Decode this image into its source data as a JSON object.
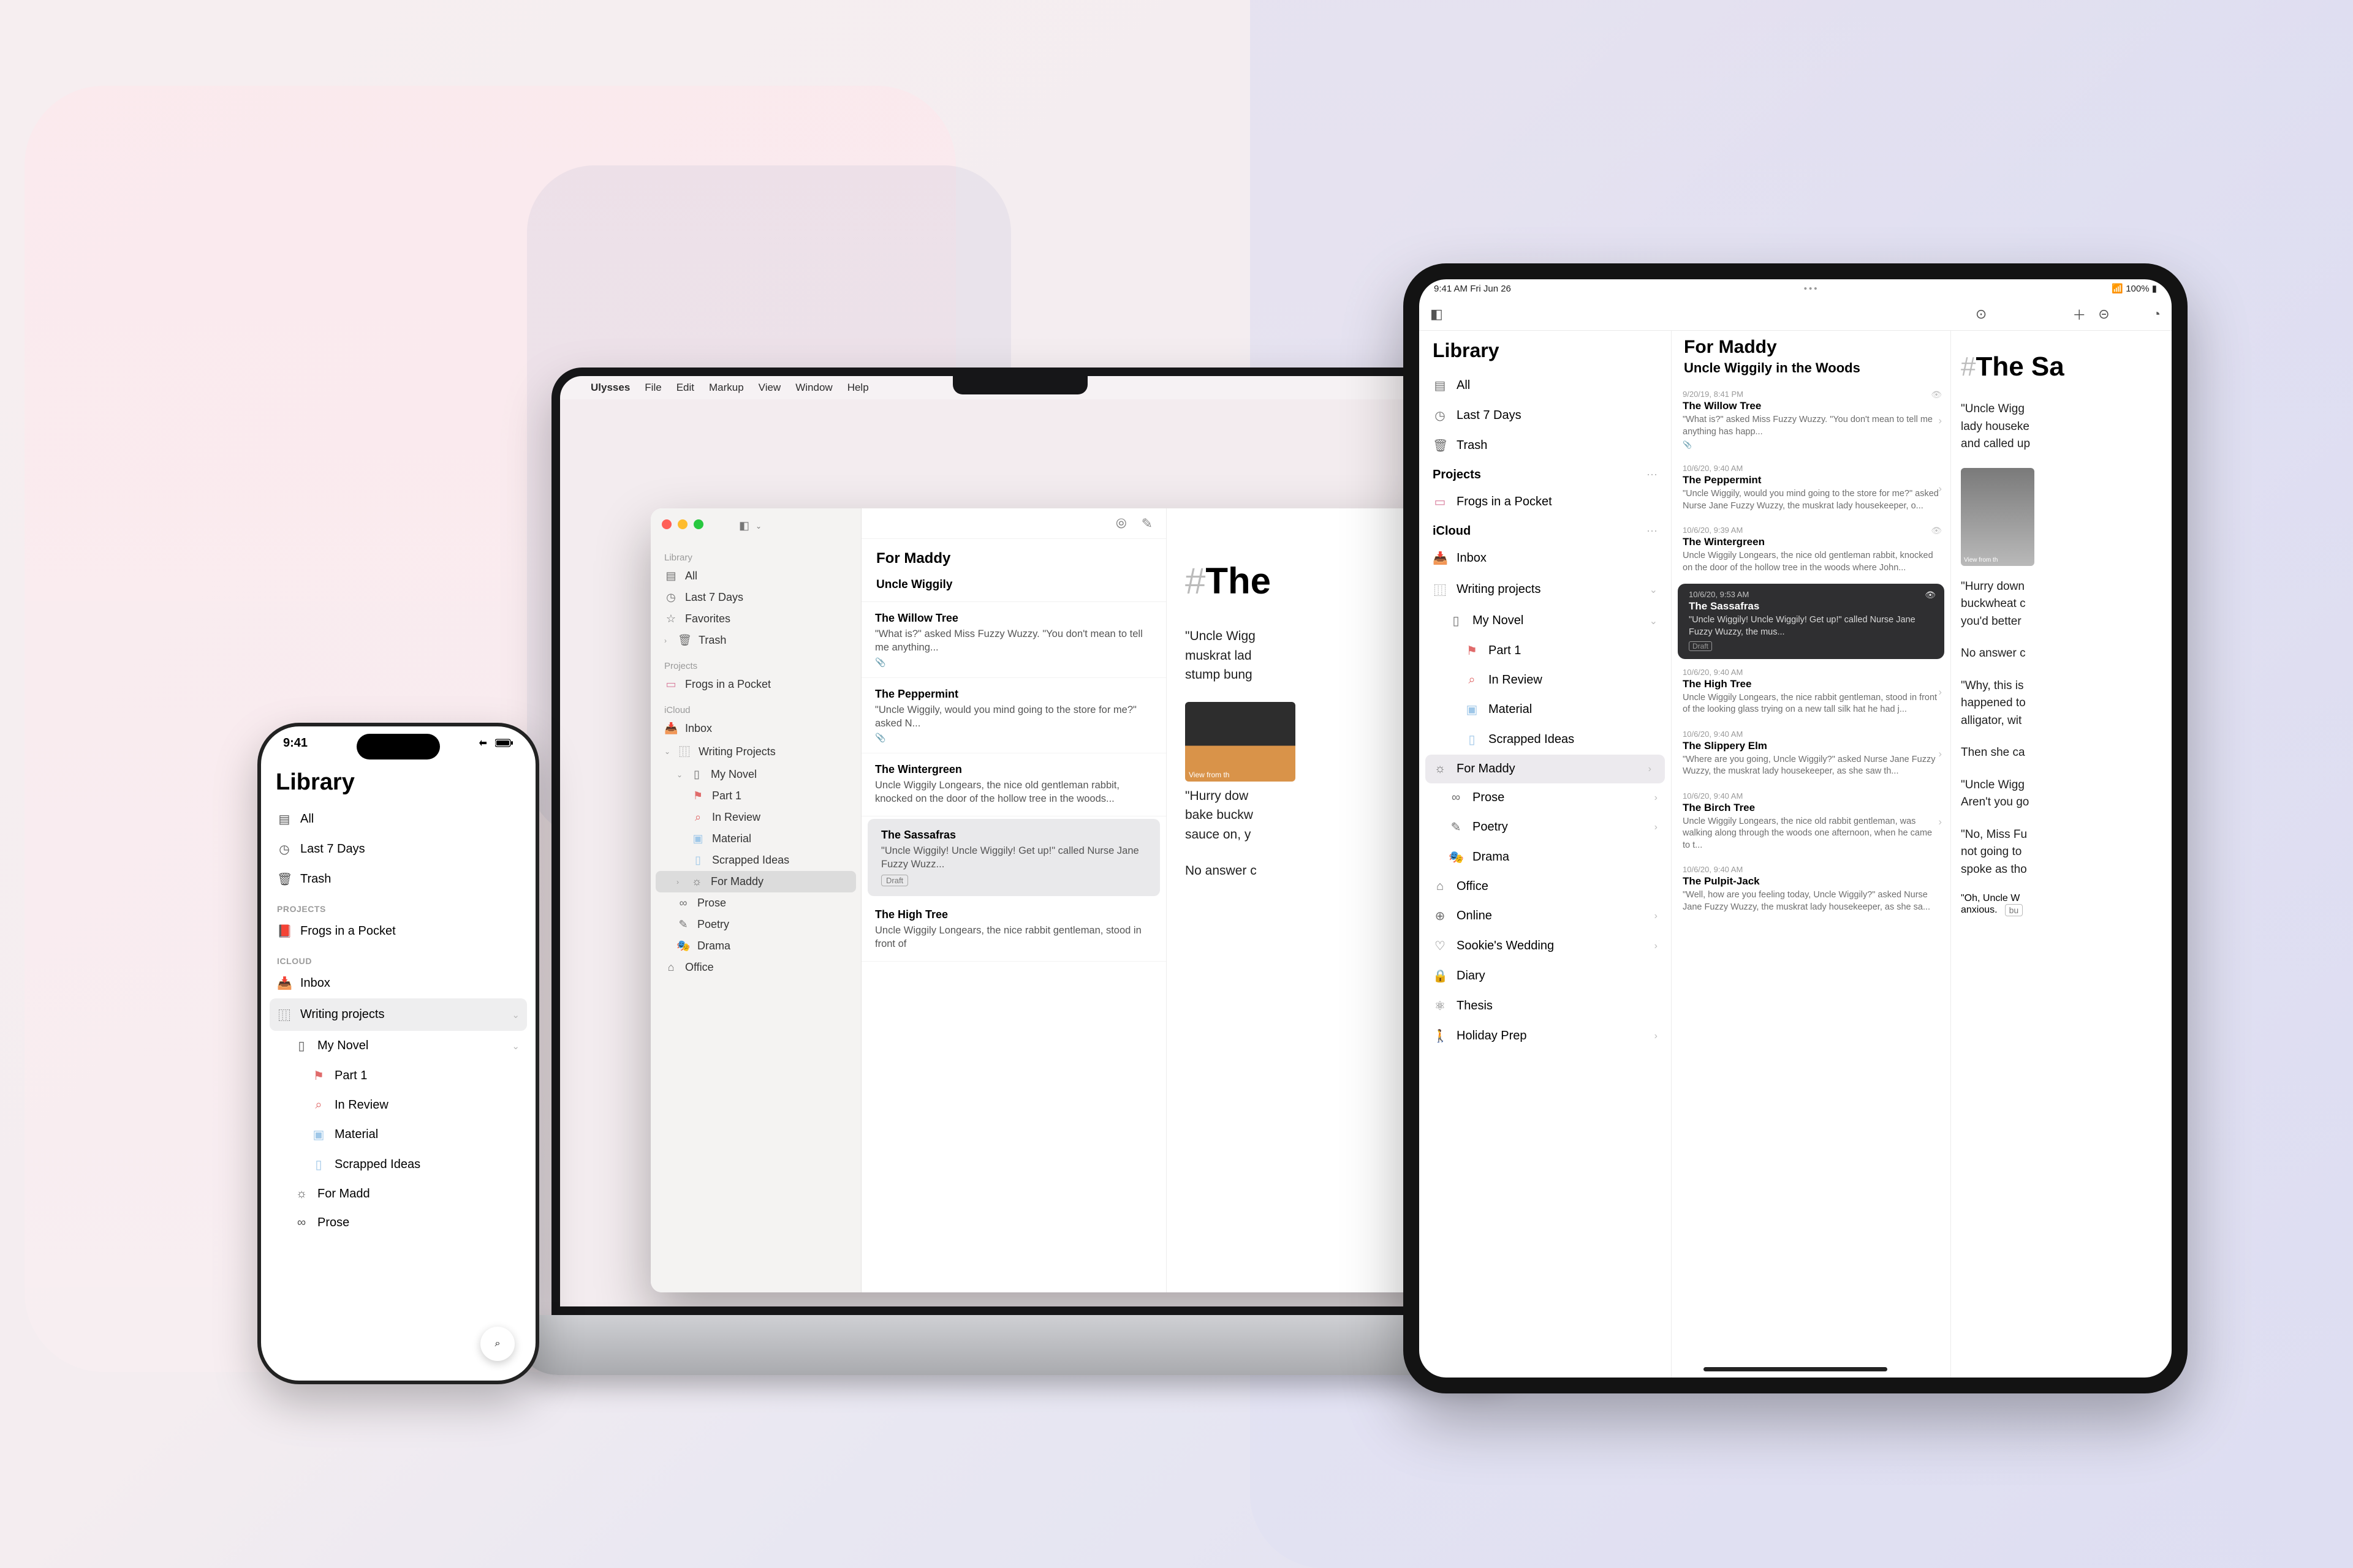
{
  "iphone": {
    "status_time": "9:41",
    "library_title": "Library",
    "filters": {
      "all": "All",
      "last7": "Last 7 Days",
      "trash": "Trash"
    },
    "projects_header": "PROJECTS",
    "project_frogs": "Frogs in a Pocket",
    "icloud_header": "ICLOUD",
    "inbox": "Inbox",
    "writing_projects": "Writing projects",
    "my_novel": "My Novel",
    "part1": "Part 1",
    "in_review": "In Review",
    "material": "Material",
    "scrapped": "Scrapped Ideas",
    "for_maddy": "For Madd",
    "prose": "Prose"
  },
  "mac": {
    "menus": {
      "apple": "",
      "ulysses": "Ulysses",
      "file": "File",
      "edit": "Edit",
      "markup": "Markup",
      "view": "View",
      "window": "Window",
      "help": "Help"
    },
    "sidebar": {
      "library_head": "Library",
      "all": "All",
      "last7": "Last 7 Days",
      "favorites": "Favorites",
      "trash": "Trash",
      "projects_head": "Projects",
      "frogs": "Frogs in a Pocket",
      "icloud_head": "iCloud",
      "inbox": "Inbox",
      "writing": "Writing Projects",
      "my_novel": "My Novel",
      "part1": "Part 1",
      "in_review": "In Review",
      "material": "Material",
      "scrapped": "Scrapped Ideas",
      "for_maddy": "For Maddy",
      "prose": "Prose",
      "poetry": "Poetry",
      "drama": "Drama",
      "office": "Office"
    },
    "list": {
      "title": "For Maddy",
      "subtitle": "Uncle Wiggily",
      "items": [
        {
          "title": "The Willow Tree",
          "snippet": "\"What is?\" asked Miss Fuzzy Wuzzy. \"You don't mean to tell me anything...",
          "attachment": true
        },
        {
          "title": "The Peppermint",
          "snippet": "\"Uncle Wiggily, would you mind going to the store for me?\" asked N...",
          "attachment": true
        },
        {
          "title": "The Wintergreen",
          "snippet": "Uncle Wiggily Longears, the nice old gentleman rabbit, knocked on the door of the hollow tree in the woods..."
        },
        {
          "title": "The Sassafras",
          "snippet": "\"Uncle Wiggily! Uncle Wiggily! Get up!\" called Nurse Jane Fuzzy Wuzz...",
          "draft": "Draft",
          "selected": true
        },
        {
          "title": "The High Tree",
          "snippet": "Uncle Wiggily Longears, the nice rabbit gentleman, stood in front of"
        }
      ]
    },
    "editor": {
      "prefix": "#",
      "heading": "The",
      "p1": "\"Uncle Wigg",
      "p1b": "muskrat lad",
      "p1c": "stump bung",
      "image_caption": "View from th",
      "p2": "\"Hurry dow",
      "p2b": "bake buckw",
      "p2c": "sauce on, y",
      "p3": "No answer c"
    }
  },
  "ipad": {
    "status_time": "9:41 AM  Fri Jun 26",
    "status_batt": "100%",
    "library_title": "Library",
    "filters": {
      "all": "All",
      "last7": "Last 7 Days",
      "trash": "Trash"
    },
    "projects_head": "Projects",
    "frogs": "Frogs in a Pocket",
    "icloud_head": "iCloud",
    "inbox": "Inbox",
    "writing": "Writing projects",
    "my_novel": "My Novel",
    "part1": "Part 1",
    "in_review": "In Review",
    "material": "Material",
    "scrapped": "Scrapped Ideas",
    "for_maddy": "For Maddy",
    "prose": "Prose",
    "poetry": "Poetry",
    "drama": "Drama",
    "office": "Office",
    "online": "Online",
    "sookie": "Sookie's Wedding",
    "diary": "Diary",
    "thesis": "Thesis",
    "holiday": "Holiday Prep",
    "list": {
      "title": "For Maddy",
      "subtitle": "Uncle Wiggily in the Woods",
      "items": [
        {
          "date": "9/20/19, 8:41 PM",
          "title": "The Willow Tree",
          "snippet": "\"What is?\" asked Miss Fuzzy Wuzzy. \"You don't mean to tell me anything has happ...",
          "attachment": true,
          "eye": true
        },
        {
          "date": "10/6/20, 9:40 AM",
          "title": "The Peppermint",
          "snippet": "\"Uncle Wiggily, would you mind going to the store for me?\" asked Nurse Jane Fuzzy Wuzzy, the muskrat lady housekeeper, o..."
        },
        {
          "date": "10/6/20, 9:39 AM",
          "title": "The Wintergreen",
          "snippet": "Uncle Wiggily Longears, the nice old gentleman rabbit, knocked on the door of the hollow tree in the woods where John...",
          "eye": true
        },
        {
          "date": "10/6/20, 9:53 AM",
          "title": "The Sassafras",
          "snippet": "\"Uncle Wiggily! Uncle Wiggily! Get up!\" called Nurse Jane Fuzzy Wuzzy, the mus...",
          "draft": "Draft",
          "selected": true,
          "eye": true
        },
        {
          "date": "10/6/20, 9:40 AM",
          "title": "The High Tree",
          "snippet": "Uncle Wiggily Longears, the nice rabbit gentleman, stood in front of the looking glass trying on a new tall silk hat he had j..."
        },
        {
          "date": "10/6/20, 9:40 AM",
          "title": "The Slippery Elm",
          "snippet": "\"Where are you going, Uncle Wiggily?\" asked Nurse Jane Fuzzy Wuzzy, the muskrat lady housekeeper, as she saw th..."
        },
        {
          "date": "10/6/20, 9:40 AM",
          "title": "The Birch Tree",
          "snippet": "Uncle Wiggily Longears, the nice old rabbit gentleman, was walking along through the woods one afternoon, when he came to t..."
        },
        {
          "date": "10/6/20, 9:40 AM",
          "title": "The Pulpit-Jack",
          "snippet": "\"Well, how are you feeling today, Uncle Wiggily?\" asked Nurse Jane Fuzzy Wuzzy, the muskrat lady housekeeper, as she sa..."
        }
      ]
    },
    "editor": {
      "prefix": "#",
      "heading": "The Sa",
      "p1": "\"Uncle Wigg",
      "p1b": "lady houseke",
      "p1c": "and called up",
      "p2": "\"Hurry down",
      "p2b": "buckwheat c",
      "p2c": "you'd better",
      "p3": "No answer c",
      "p4a": "\"Why, this is",
      "p4b": "happened to",
      "p4c": "alligator, wit",
      "p5": "Then she ca",
      "p6a": "\"Uncle Wigg",
      "p6b": "Aren't you go",
      "p7a": "\"No, Miss Fu",
      "p7b": "not going to",
      "p7c": "spoke as tho",
      "p8a": "\"Oh, Uncle W",
      "p8b": "anxious.",
      "p8tag": "bu"
    }
  }
}
